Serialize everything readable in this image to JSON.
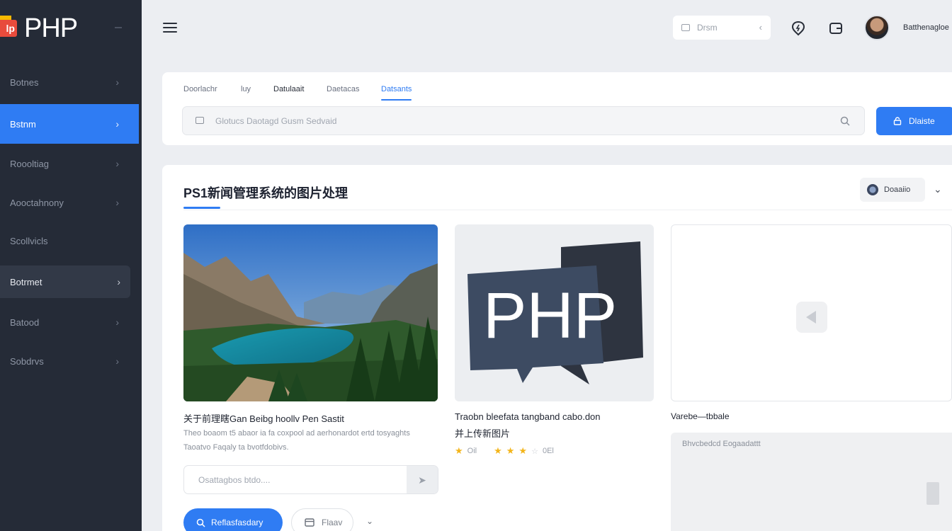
{
  "logo": {
    "badge": "lp",
    "text": "PHP"
  },
  "sidebar": {
    "items": [
      {
        "label": "Botnes"
      },
      {
        "label": "Bstnm"
      },
      {
        "label": "Roooltiag"
      },
      {
        "label": "Aooctahnony"
      },
      {
        "label": "Scollvicls"
      },
      {
        "label": "Botrmet"
      },
      {
        "label": "Batood"
      },
      {
        "label": "Sobdrvs"
      }
    ]
  },
  "topbar": {
    "search_placeholder": "Drsm",
    "user_name": "Batthenagloe"
  },
  "filters": {
    "tabs": [
      "Doorlachr",
      "luy",
      "Datulaait",
      "Daetacas",
      "Datsants"
    ],
    "search_placeholder": "Glotucs Daotagd Gusm Sedvaid",
    "button_label": "Dlaiste"
  },
  "content": {
    "title": "PS1新闻管理系统的图片处理",
    "sort_label": "Doaaiio"
  },
  "cards": [
    {
      "title": "关于前理瞎Gan Beibg hoollv Pen Sastit",
      "desc": [
        "Theo boaom t5 abaor ia fa coxpool ad aerhonardot ertd tosyaghts",
        "Taoatvo Faqaly ta bvotfdobivs."
      ],
      "comment_placeholder": "Osattagbos btdo....",
      "primary_label": "Reflasfasdary",
      "secondary_label": "Flaav"
    },
    {
      "title_line1": "Traobn bleefata tangband cabo.don",
      "title_line2": "并上传新图片",
      "logo_text": "PHP",
      "rating_label": "Oil",
      "rating_count": "0El"
    },
    {
      "title": "Varebe—tbbale",
      "panel_text": "Bhvcbedcd Eogaadattt"
    }
  ]
}
